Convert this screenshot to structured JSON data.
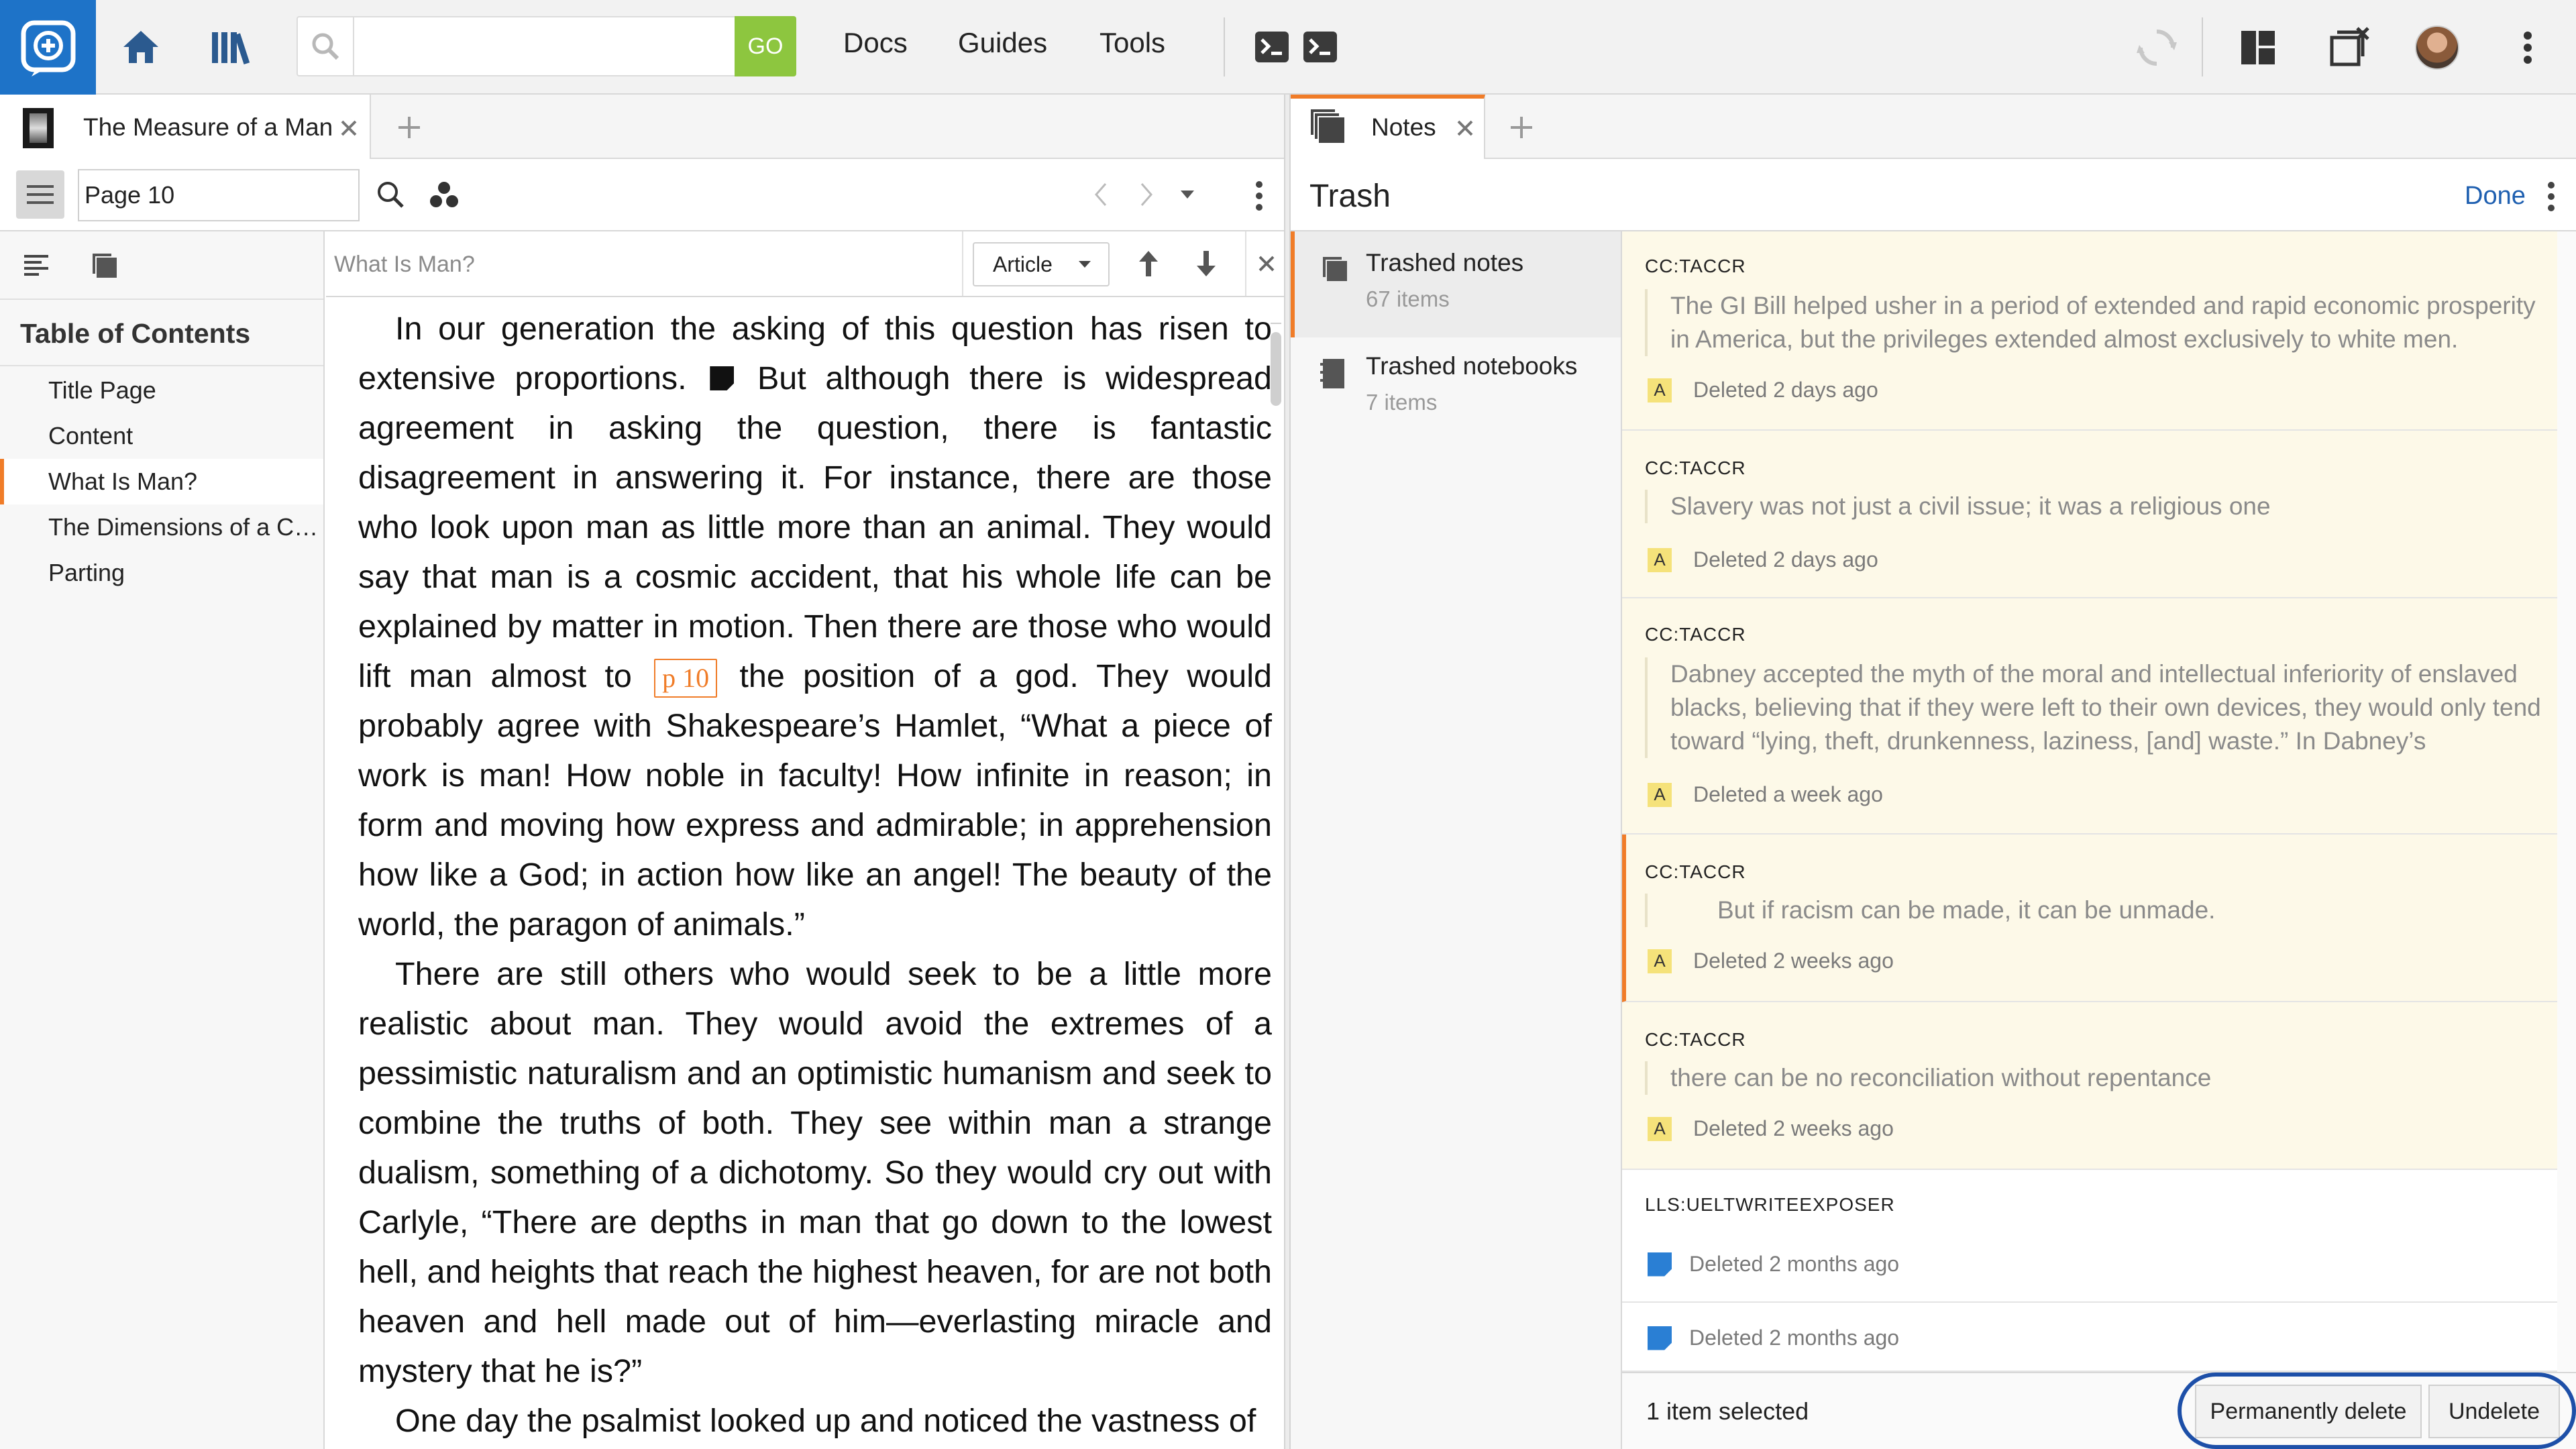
{
  "topbar": {
    "search": {
      "value": "",
      "placeholder": "",
      "go_label": "GO"
    },
    "nav": [
      "Docs",
      "Guides",
      "Tools"
    ],
    "icons": [
      "logos-search-logo-icon",
      "home-icon",
      "library-icon",
      "terminal-icon",
      "terminal-icon",
      "sync-icon",
      "layout-icon",
      "close-tabs-icon",
      "avatar",
      "more-vertical-icon"
    ]
  },
  "left_panel": {
    "tab_title": "The Measure of a Man",
    "page_value": "Page 10",
    "find": {
      "placeholder": "What Is Man?",
      "scope": "Article"
    },
    "toc": {
      "title": "Table of Contents",
      "items": [
        "Title Page",
        "Content",
        "What Is Man?",
        "The Dimensions of a C…",
        "Parting"
      ],
      "active_index": 2
    },
    "reader": {
      "p1_a": "In our generation the asking of this question has risen to extensive proportions.",
      "p1_b": "But although there is widespread agreement in asking the question, there is fantastic disagreement in answering it. For instance, there are those who look upon man as little more than an animal. They would say that man is a cosmic accident, that his whole life can be explained by matter in motion. Then there are those who would lift man almost to",
      "page_marker": "p 10",
      "p1_c": "the position of a god. They would probably agree with Shakespeare’s Hamlet, “What a piece of work is man! How noble in faculty! How infinite in reason; in form and moving how express and admirable; in apprehension how like a God; in action how like an angel! The beauty of the world, the paragon of animals.”",
      "p2": "There are still others who would seek to be a little more realistic about man. They would avoid the extremes of a pessimistic naturalism and an optimistic humanism and seek to combine the truths of both. They see within man a strange dualism, something of a dichotomy. So they would cry out with Carlyle, “There are depths in man that go down to the lowest hell, and heights that reach the highest heaven, for are not both heaven and hell made out of him—everlasting miracle and mystery that he is?”",
      "p3": "One day the psalmist looked up and noticed the vastness of"
    }
  },
  "right_panel": {
    "tab_title": "Notes",
    "header": {
      "title": "Trash",
      "done_label": "Done"
    },
    "nav": [
      {
        "label": "Trashed notes",
        "count": "67 items"
      },
      {
        "label": "Trashed notebooks",
        "count": "7 items"
      }
    ],
    "notes": [
      {
        "source": "CC:TACCR",
        "quote": "The GI Bill helped usher in a period of extended and rapid economic prosperity in America, but the privileges extended almost exclusively to white men.",
        "badge": "A",
        "deleted": "Deleted 2 days ago"
      },
      {
        "source": "CC:TACCR",
        "quote": "Slavery was not just a civil issue; it was a religious one",
        "badge": "A",
        "deleted": "Deleted 2 days ago"
      },
      {
        "source": "CC:TACCR",
        "quote": "Dabney accepted the myth of the moral and intellectual inferiority of enslaved blacks, believing that if they were left to their own devices, they would only tend toward “lying, theft, drunkenness, laziness, [and] waste.” In Dabney’s",
        "badge": "A",
        "deleted": "Deleted a week ago"
      },
      {
        "source": "CC:TACCR",
        "quote": "But if racism can be made, it can be unmade.",
        "badge": "A",
        "deleted": "Deleted 2 weeks ago"
      },
      {
        "source": "CC:TACCR",
        "quote": "there can be no reconciliation without repentance",
        "badge": "A",
        "deleted": "Deleted 2 weeks ago"
      },
      {
        "source": "LLS:UELTWRITEEXPOSER",
        "quote": "",
        "badge": "",
        "deleted": "Deleted 2 months ago"
      },
      {
        "source": "",
        "quote": "",
        "badge": "",
        "deleted": "Deleted 2 months ago"
      }
    ],
    "status": {
      "selected": "1 item selected",
      "permanently_delete": "Permanently delete",
      "undelete": "Undelete"
    }
  },
  "colors": {
    "accent": "#f07c28",
    "brand": "#1e73c8",
    "go": "#8dc63f",
    "highlight": "#fdf9e8",
    "badge": "#f5e27a",
    "ring": "#1d4fa8"
  }
}
